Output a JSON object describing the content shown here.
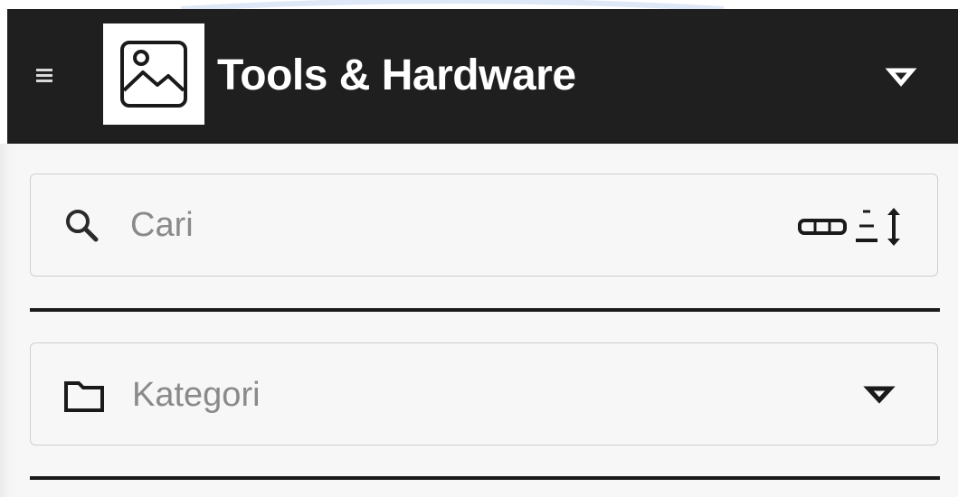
{
  "header": {
    "title": "Tools & Hardware",
    "background": "#1f1f1f",
    "title_color": "#ffffff"
  },
  "icons": {
    "menu": "hamburger-menu-icon",
    "logo": "image-placeholder-icon",
    "header_dropdown": "triangle-down-icon",
    "search": "search-icon",
    "sort": "sort-filter-icon",
    "folder": "folder-icon",
    "category_dropdown": "triangle-down-icon"
  },
  "search": {
    "placeholder": "Cari",
    "value": ""
  },
  "category": {
    "placeholder": "Kategori"
  }
}
